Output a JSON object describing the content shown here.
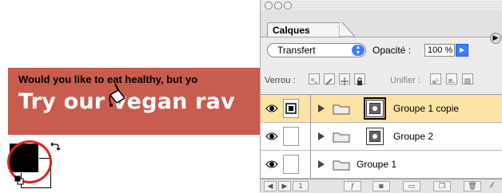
{
  "banner": {
    "subtitle": "Would you like to eat healthy, but yo",
    "headline": "Try our vegan rav",
    "background": "#c85c4e"
  },
  "tools": {
    "cursor_icon": "paint-bucket-icon",
    "foreground_color": "#000000",
    "background_color": "#ffffff",
    "highlight_color": "#e02020"
  },
  "panel": {
    "tab_label": "Calques",
    "blend_mode": "Transfert",
    "opacity_label": "Opacité :",
    "opacity_value": "100 %",
    "lock_label": "Verrou :",
    "unify_label": "Unifier :",
    "selection_color": "#fde4a4",
    "accent": "#3d7cff",
    "layers": [
      {
        "name": "Groupe 1 copie",
        "selected": true,
        "has_thumb": true
      },
      {
        "name": "Groupe 2",
        "selected": false,
        "has_thumb": true
      },
      {
        "name": "Groupe 1",
        "selected": false,
        "has_thumb": false
      }
    ],
    "footer_page": "1"
  }
}
